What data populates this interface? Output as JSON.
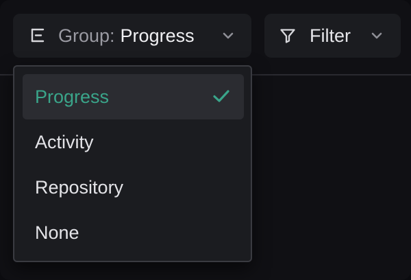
{
  "toolbar": {
    "group_button": {
      "prefix": "Group:",
      "value": "Progress",
      "icon": "group-by-icon"
    },
    "filter_button": {
      "label": "Filter",
      "icon": "filter-funnel-icon"
    }
  },
  "group_menu": {
    "items": [
      {
        "label": "Progress",
        "selected": true
      },
      {
        "label": "Activity",
        "selected": false
      },
      {
        "label": "Repository",
        "selected": false
      },
      {
        "label": "None",
        "selected": false
      }
    ],
    "selected_icon": "check-icon"
  },
  "colors": {
    "background": "#101014",
    "button_bg": "#1b1c20",
    "accent": "#3aa58a",
    "text": "#e6e6ea",
    "muted_text": "#9a9aa2"
  }
}
